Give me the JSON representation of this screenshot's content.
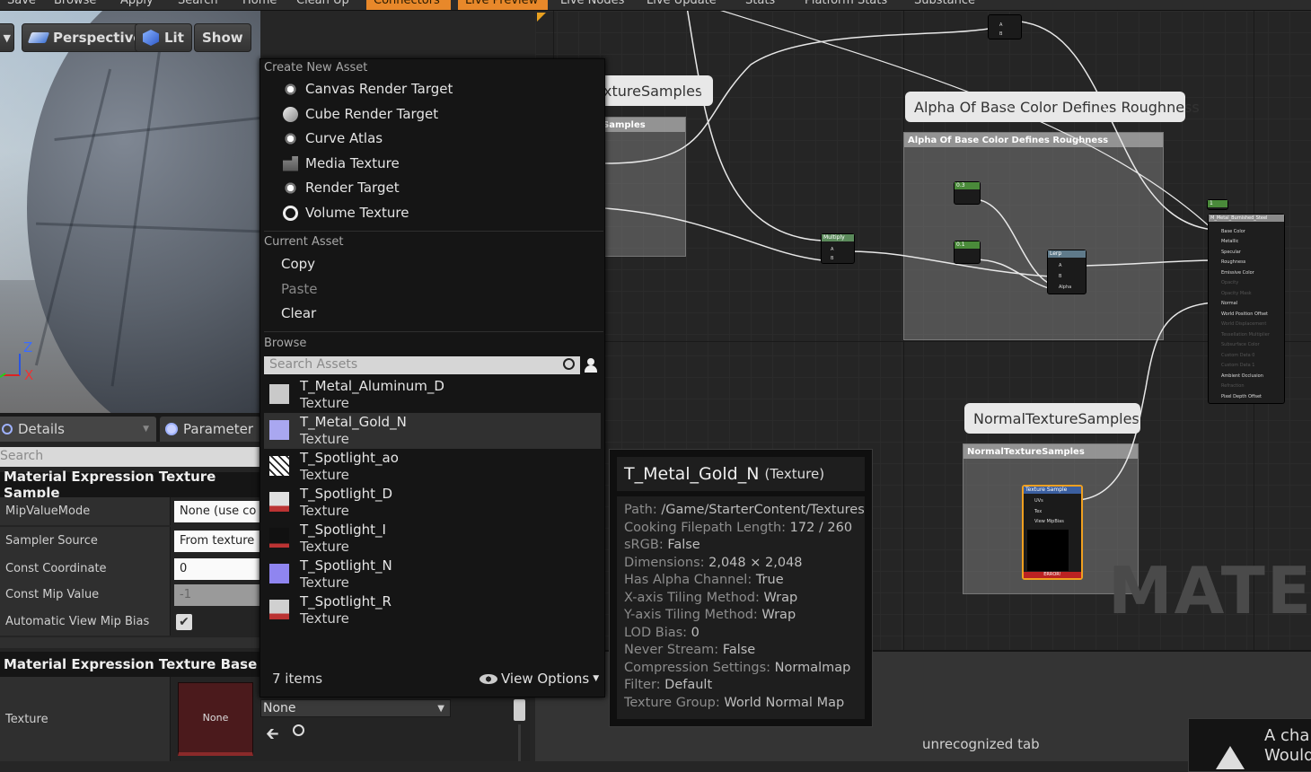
{
  "toolbar": {
    "items": [
      "Save",
      "Browse",
      "Apply",
      "Search",
      "Home",
      "Clean Up",
      "Connectors",
      "Live Preview",
      "Live Nodes",
      "Live Update",
      "Stats",
      "Platform Stats",
      "Substance"
    ]
  },
  "viewport": {
    "perspective_label": "Perspective",
    "lit_label": "Lit",
    "show_label": "Show",
    "axis_z": "Z",
    "axis_x": "X"
  },
  "details": {
    "tab_details": "Details",
    "tab_parameters": "Parameter",
    "search_placeholder": "Search",
    "section_texture_sample": "Material Expression Texture Sample",
    "mip_value_mode_label": "MipValueMode",
    "mip_value_mode_value": "None (use co",
    "sampler_source_label": "Sampler Source",
    "sampler_source_value": "From texture",
    "const_coordinate_label": "Const Coordinate",
    "const_coordinate_value": "0",
    "const_mip_value_label": "Const Mip Value",
    "const_mip_value_value": "-1",
    "auto_view_mip_bias_label": "Automatic View Mip Bias",
    "section_texture_base": "Material Expression Texture Base",
    "texture_label": "Texture",
    "texture_thumb_text": "None",
    "texture_combo_value": "None"
  },
  "menu": {
    "create_new_asset_header": "Create New Asset",
    "create_items": [
      "Canvas Render Target",
      "Cube Render Target",
      "Curve Atlas",
      "Media Texture",
      "Render Target",
      "Volume Texture"
    ],
    "current_asset_header": "Current Asset",
    "copy": "Copy",
    "paste": "Paste",
    "clear": "Clear",
    "browse_header": "Browse",
    "search_placeholder": "Search Assets",
    "assets": [
      {
        "name": "T_Metal_Aluminum_D",
        "type": "Texture",
        "thumb": "#c9c9c9"
      },
      {
        "name": "T_Metal_Gold_N",
        "type": "Texture",
        "thumb": "#a9a7f0"
      },
      {
        "name": "T_Spotlight_ao",
        "type": "Texture",
        "thumb": "#ffffff"
      },
      {
        "name": "T_Spotlight_D",
        "type": "Texture",
        "thumb": "#d9d9d9"
      },
      {
        "name": "T_Spotlight_I",
        "type": "Texture",
        "thumb": "#111111"
      },
      {
        "name": "T_Spotlight_N",
        "type": "Texture",
        "thumb": "#8f85f0"
      },
      {
        "name": "T_Spotlight_R",
        "type": "Texture",
        "thumb": "#d0d0d0"
      }
    ],
    "items_count": "7 items",
    "view_options": "View Options"
  },
  "tooltip": {
    "title": "T_Metal_Gold_N",
    "title_suffix": "(Texture)",
    "rows": [
      {
        "k": "Path:",
        "v": "/Game/StarterContent/Textures"
      },
      {
        "k": "Cooking Filepath Length:",
        "v": "172 / 260"
      },
      {
        "k": "sRGB:",
        "v": "False"
      },
      {
        "k": "Dimensions:",
        "v": "2,048 × 2,048"
      },
      {
        "k": "Has Alpha Channel:",
        "v": "True"
      },
      {
        "k": "X-axis Tiling Method:",
        "v": "Wrap"
      },
      {
        "k": "Y-axis Tiling Method:",
        "v": "Wrap"
      },
      {
        "k": "LOD Bias:",
        "v": "0"
      },
      {
        "k": "Never Stream:",
        "v": "False"
      },
      {
        "k": "Compression Settings:",
        "v": "Normalmap"
      },
      {
        "k": "Filter:",
        "v": "Default"
      },
      {
        "k": "Texture Group:",
        "v": "World Normal Map"
      }
    ]
  },
  "graph": {
    "comment_texture_samples_bubble": "xtureSamples",
    "comment_texture_samples_header": "Samples",
    "comment_alpha_bubble": "Alpha Of Base Color Defines Roughness",
    "comment_alpha_header": "Alpha Of Base Color Defines Roughness",
    "comment_normal_bubble": "NormalTextureSamples",
    "comment_normal_header": "NormalTextureSamples",
    "multiply_node": "Multiply",
    "lerp_node": "Lerp",
    "const_a": "0.3",
    "const_b": "0.1",
    "const_c": "1",
    "pin_a": "A",
    "pin_b": "B",
    "pin_alpha": "Alpha",
    "result_node_title": "M_Metal_Burnished_Steel",
    "result_pins": [
      "Base Color",
      "Metallic",
      "Specular",
      "Roughness",
      "Emissive Color",
      "Opacity",
      "Opacity Mask",
      "Normal",
      "World Position Offset",
      "World Displacement",
      "Tessellation Multiplier",
      "Subsurface Color",
      "Custom Data 0",
      "Custom Data 1",
      "Ambient Occlusion",
      "Refraction",
      "Pixel Depth Offset"
    ],
    "texture_sample_node": "Texture Sample",
    "ts_pins": [
      "UVs",
      "Tex",
      "View MipBias"
    ],
    "ts_error": "ERROR!",
    "watermark": "MATER"
  },
  "lower": {
    "unrecognized_tab": "unrecognized tab",
    "warn_text_1": "A char",
    "warn_text_2": "Would"
  }
}
